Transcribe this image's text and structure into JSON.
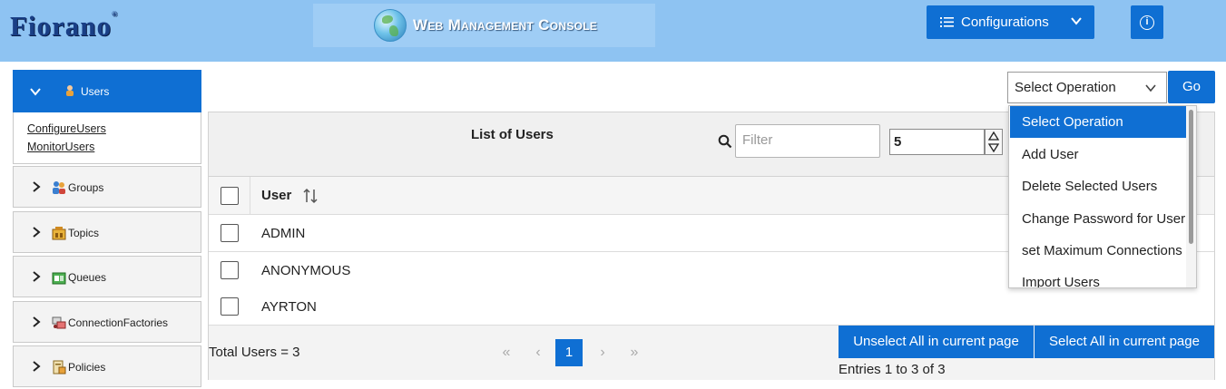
{
  "header": {
    "logo": "Fiorano",
    "logo_mark": "®",
    "title": "Web Management Console",
    "configurations_label": "Configurations",
    "info_label": "i"
  },
  "sidebar": {
    "active": {
      "label": "Users",
      "icon": "users-icon"
    },
    "sub_links": [
      "ConfigureUsers",
      "MonitorUsers"
    ],
    "items": [
      {
        "label": "Groups",
        "icon": "groups-icon"
      },
      {
        "label": "Topics",
        "icon": "topics-icon"
      },
      {
        "label": "Queues",
        "icon": "queues-icon"
      },
      {
        "label": "ConnectionFactories",
        "icon": "connection-factories-icon"
      },
      {
        "label": "Policies",
        "icon": "policies-icon"
      }
    ]
  },
  "operation": {
    "selected": "Select Operation",
    "go_label": "Go",
    "options": [
      "Select Operation",
      "Add User",
      "Delete Selected Users",
      "Change Password for User",
      "set Maximum Connections",
      "Import Users"
    ]
  },
  "table": {
    "title": "List of Users",
    "filter_placeholder": "Filter",
    "page_size": "5",
    "column_user": "User",
    "rows": [
      "ADMIN",
      "ANONYMOUS",
      "AYRTON"
    ],
    "total": "Total Users = 3",
    "pagination": {
      "first": "«",
      "prev": "‹",
      "current": "1",
      "next": "›",
      "last": "»"
    },
    "unselect_all_label": "Unselect All in current page",
    "select_all_label": "Select All in current page",
    "entries": "Entries 1 to 3 of 3"
  },
  "colors": {
    "accent": "#0f6fd3",
    "header_bg": "#8ec3f2"
  }
}
